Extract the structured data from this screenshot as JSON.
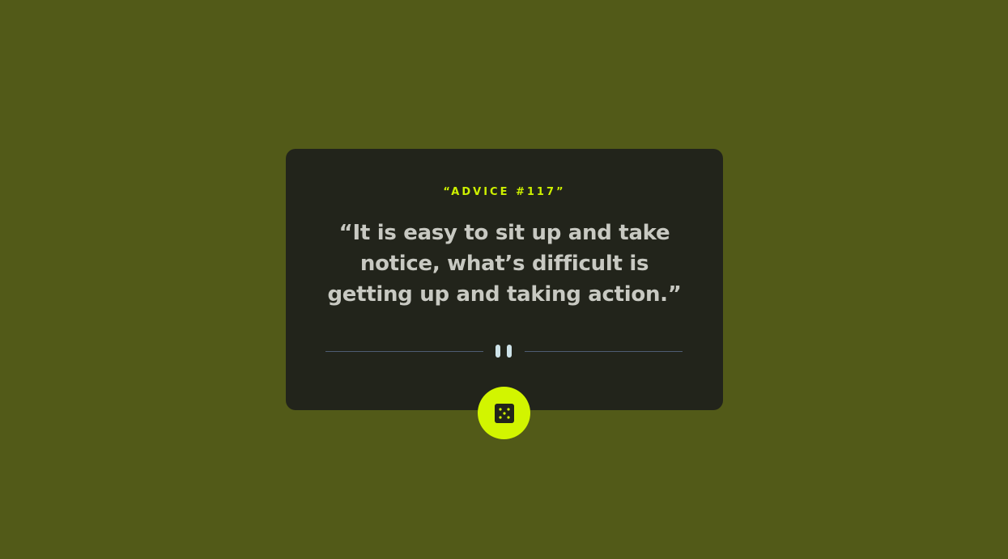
{
  "advice": {
    "id_label": "“ADVICE #117”",
    "quote": "“It is easy to sit up and take notice, what’s difficult is getting up and taking action.”"
  },
  "divider": {
    "icon": "pause-icon"
  },
  "button": {
    "icon": "dice-icon"
  },
  "colors": {
    "background": "#525a18",
    "card": "#22241b",
    "accent": "#cdf000",
    "quote_text": "#c8c9c2",
    "divider_line": "#4e5d73"
  }
}
